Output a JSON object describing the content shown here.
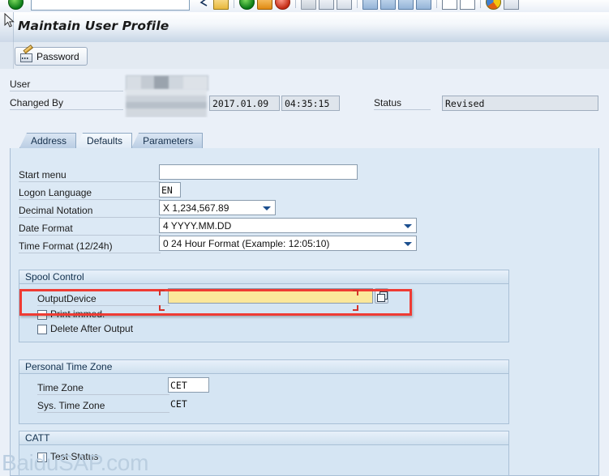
{
  "toolbar": {
    "command_field_value": "",
    "icons": [
      "back-green-icon",
      "save-yellow-icon",
      "check-green-icon",
      "cancel-orange-icon",
      "exit-red-icon",
      "print-icon",
      "find-icon",
      "find-next-icon",
      "first-page-icon",
      "previous-page-icon",
      "next-page-icon",
      "last-page-icon",
      "spreadsheet-icon",
      "export-icon",
      "help-icon",
      "layout-menu-icon"
    ]
  },
  "window": {
    "title": "Maintain User Profile"
  },
  "app_toolbar": {
    "password_label": "Password",
    "password_icon": "password-card-pen-icon"
  },
  "header": {
    "user_label": "User",
    "user_value": "",
    "changed_by_label": "Changed By",
    "changed_by_value": "",
    "changed_date": "2017.01.09",
    "changed_time": "04:35:15",
    "status_label": "Status",
    "status_value": "Revised"
  },
  "tabs": [
    {
      "label": "Address",
      "selected": false
    },
    {
      "label": "Defaults",
      "selected": true
    },
    {
      "label": "Parameters",
      "selected": false
    }
  ],
  "defaults": {
    "fields": [
      {
        "label": "Start menu",
        "value": "",
        "type": "input"
      },
      {
        "label": "Logon Language",
        "value": "EN",
        "type": "input-mono"
      },
      {
        "label": "Decimal Notation",
        "value": "X 1,234,567.89",
        "type": "dropdown"
      },
      {
        "label": "Date Format",
        "value": "4 YYYY.MM.DD",
        "type": "dropdown"
      },
      {
        "label": "Time Format (12/24h)",
        "value": "0 24 Hour Format (Example: 12:05:10)",
        "type": "dropdown"
      }
    ]
  },
  "spool_control": {
    "title": "Spool Control",
    "output_device_label": "OutputDevice",
    "output_device_value": "",
    "output_device_placeholder": "",
    "search_help_icon": "search-help-f4-icon",
    "print_immed_label": "Print immed.",
    "print_immed_checked": false,
    "delete_after_output_label": "Delete After Output",
    "delete_after_output_checked": false
  },
  "personal_time_zone": {
    "title": "Personal Time Zone",
    "time_zone_label": "Time Zone",
    "time_zone_value": "CET",
    "sys_time_zone_label": "Sys. Time Zone",
    "sys_time_zone_value": "CET"
  },
  "catt": {
    "title": "CATT",
    "test_status_label": "Test Status",
    "test_status_checked": false
  },
  "annotation": {
    "highlight_color": "#ef3b33"
  },
  "watermark": {
    "text": "BaiduSAP.com"
  }
}
